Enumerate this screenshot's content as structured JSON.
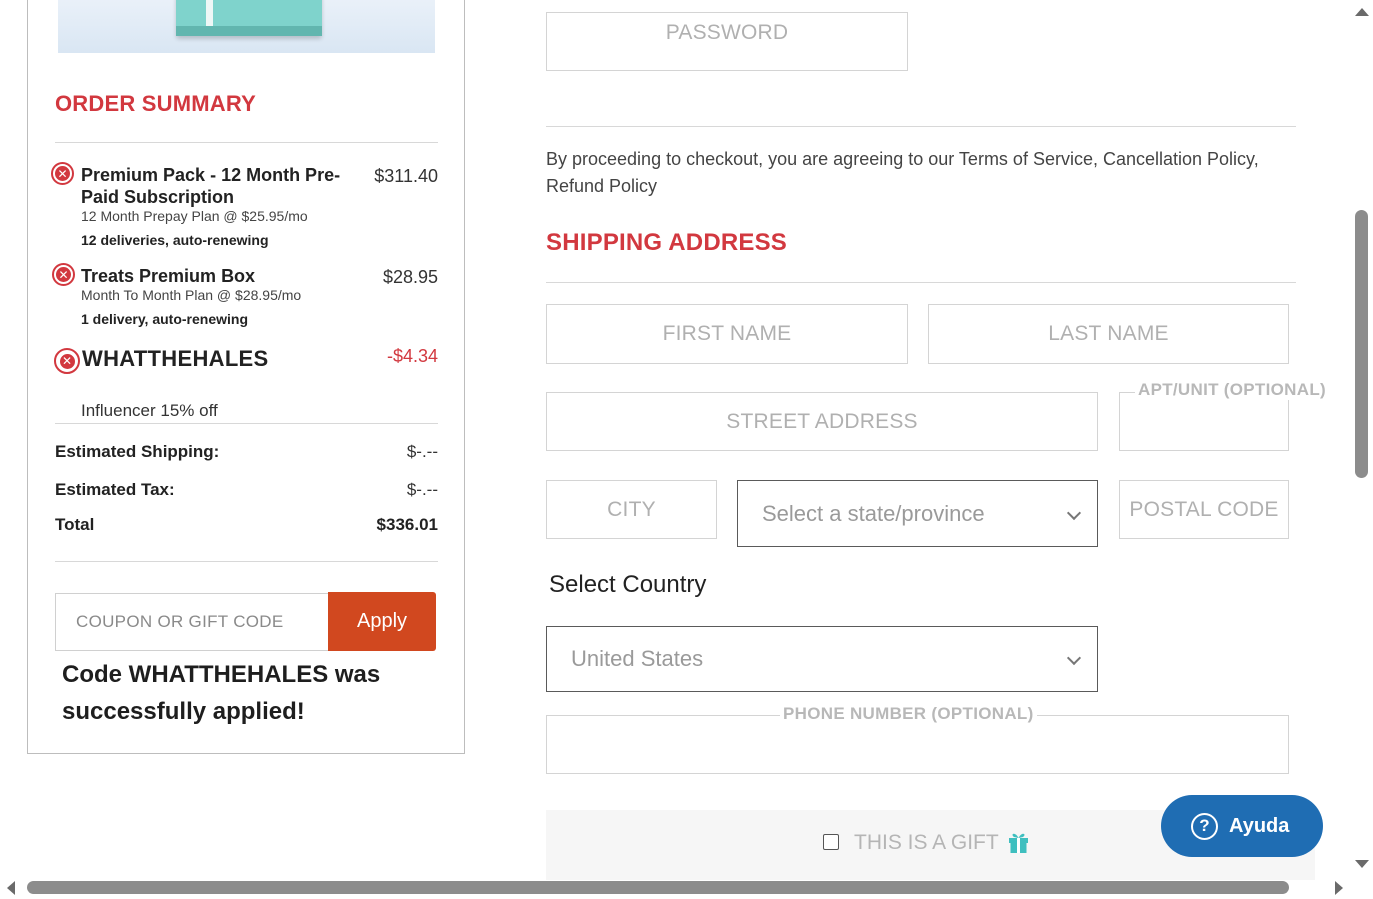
{
  "order_summary": {
    "title": "ORDER SUMMARY",
    "items": [
      {
        "name": "Premium Pack - 12 Month Pre-Paid Subscription",
        "plan": "12 Month Prepay Plan @ $25.95/mo",
        "deliveries": "12 deliveries, auto-renewing",
        "price": "$311.40",
        "remove_symbol": "✕"
      },
      {
        "name": "Treats Premium Box",
        "plan": "Month To Month Plan @ $28.95/mo",
        "deliveries": "1 delivery, auto-renewing",
        "price": "$28.95",
        "remove_symbol": "✕"
      }
    ],
    "promo": {
      "code": "WHATTHEHALES",
      "value": "-$4.34",
      "description": "Influencer 15% off",
      "remove_symbol": "✕"
    },
    "shipping_label": "Estimated Shipping:",
    "shipping_value": "$-.--",
    "tax_label": "Estimated Tax:",
    "tax_value": "$-.--",
    "total_label": "Total",
    "total_value": "$336.01"
  },
  "coupon": {
    "placeholder": "COUPON OR GIFT CODE",
    "apply_label": "Apply",
    "success_message": "Code WHATTHEHALES was successfully applied!"
  },
  "account": {
    "password_placeholder": "PASSWORD"
  },
  "terms": {
    "text": "By proceeding to checkout, you are agreeing to our Terms of Service, Cancellation Policy, Refund Policy"
  },
  "shipping": {
    "title": "SHIPPING ADDRESS",
    "first_name": "FIRST NAME",
    "last_name": "LAST NAME",
    "street": "STREET ADDRESS",
    "apt_label": "APT/UNIT (OPTIONAL)",
    "city": "CITY",
    "state_placeholder": "Select a state/province",
    "postal": "POSTAL CODE",
    "country_label": "Select Country",
    "country_value": "United States",
    "phone_label": "PHONE NUMBER (OPTIONAL)",
    "gift_label": "THIS IS A GIFT",
    "gift_icon": "gift-icon"
  },
  "help": {
    "label": "Ayuda",
    "icon_symbol": "?"
  },
  "colors": {
    "accent_red": "#d2383f",
    "apply_orange": "#d1481f",
    "help_blue": "#1f6db3",
    "gift_teal": "#3fbfbf"
  }
}
